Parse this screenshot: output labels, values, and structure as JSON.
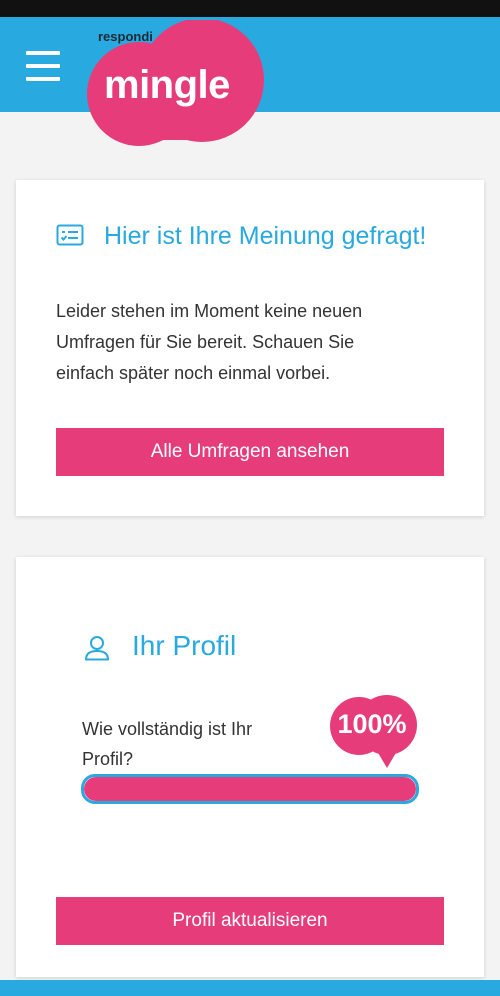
{
  "header": {
    "menu_icon": "hamburger-menu-icon",
    "logo": {
      "brand": "respondi",
      "name": "mingle"
    },
    "colors": {
      "header_bg": "#28a9df",
      "logo_bg": "#e63d7a"
    }
  },
  "survey_card": {
    "icon": "survey-list-icon",
    "title": "Hier ist Ihre Meinung gefragt!",
    "text": "Leider stehen im Moment keine neuen Umfragen für Sie bereit. Schauen Sie einfach später noch einmal vorbei.",
    "button_label": "Alle Umfragen ansehen"
  },
  "profile_card": {
    "icon": "user-icon",
    "title": "Ihr Profil",
    "question": "Wie vollständig ist Ihr Profil?",
    "completion_label": "100%",
    "completion_fraction": 1.0,
    "button_label": "Profil aktualisieren"
  },
  "colors": {
    "accent_blue": "#28a9df",
    "accent_pink": "#e63d7a"
  }
}
